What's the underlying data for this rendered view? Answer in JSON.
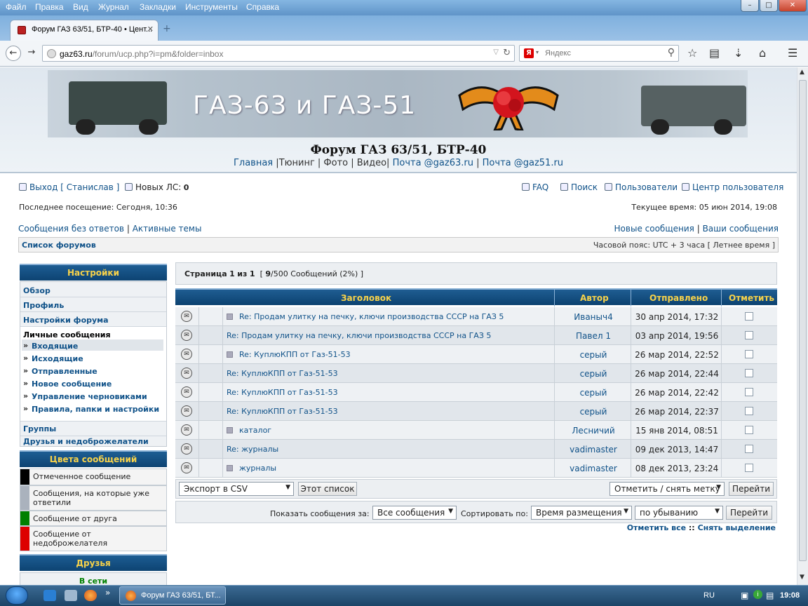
{
  "menubar": {
    "items": [
      "Файл",
      "Правка",
      "Вид",
      "Журнал",
      "Закладки",
      "Инструменты",
      "Справка"
    ]
  },
  "window": {
    "min": "–",
    "max": "□",
    "close": "✕"
  },
  "tab": {
    "title": "Форум ГАЗ 63/51, БТР-40 • Цент...",
    "close": "✕",
    "new": "+"
  },
  "nav": {
    "back": "←",
    "forward": "→",
    "url_host": "gaz63.ru",
    "url_path": "/forum/ucp.php?i=pm&folder=inbox",
    "search_placeholder": "Яндекс",
    "search_engine": "Я"
  },
  "banner": {
    "title": "ГАЗ-63 и ГАЗ-51"
  },
  "forum": {
    "title": "Форум ГАЗ 63/51, БТР-40",
    "links": [
      "Главная",
      "|Тюнинг | Фото | Видео|",
      "Почта @gaz63.ru",
      "|",
      "Почта @gaz51.ru"
    ]
  },
  "userbar": {
    "logout": "Выход [ Станислав ]",
    "new_pm": "Новых ЛС:",
    "new_pm_count": "0",
    "faq": "FAQ",
    "search": "Поиск",
    "members": "Пользователи",
    "ucp": "Центр пользователя",
    "last_visit": "Последнее посещение: Сегодня, 10:36",
    "current_time": "Текущее время: 05 июн 2014, 19:08",
    "unanswered": "Сообщения без ответов",
    "sep": "|",
    "active": "Активные темы",
    "new_posts": "Новые сообщения",
    "your_posts": "Ваши сообщения"
  },
  "crumbs": {
    "forum_index": "Список форумов",
    "timezone": "Часовой пояс: UTC + 3 часа [ Летнее время ]"
  },
  "sidebar": {
    "settings_head": "Настройки",
    "items": [
      "Обзор",
      "Профиль",
      "Настройки форума"
    ],
    "pm_label": "Личные сообщения",
    "pm_items": [
      "Входящие",
      "Исходящие",
      "Отправленные",
      "Новое сообщение",
      "Управление черновиками",
      "Правила, папки и настройки"
    ],
    "groups": "Группы",
    "friends_foes": "Друзья и недоброжелатели",
    "colors_head": "Цвета сообщений",
    "colors": [
      {
        "label": "Отмеченное сообщение",
        "color": "#000000"
      },
      {
        "label": "Сообщения, на которые уже ответили",
        "color": "#aab2bd"
      },
      {
        "label": "Сообщение от друга",
        "color": "#008000"
      },
      {
        "label": "Сообщение от недоброжелателя",
        "color": "#dd0000"
      }
    ],
    "friends_head": "Друзья",
    "online": "В сети"
  },
  "pagination": {
    "page": "Страница",
    "cur": "1",
    "of": "из",
    "total": "1",
    "open": "[",
    "count": "9",
    "rest": "/500 Сообщений (2%) ]"
  },
  "table": {
    "headers": {
      "subject": "Заголовок",
      "author": "Автор",
      "sent": "Отправлено",
      "mark": "Отметить"
    },
    "rows": [
      {
        "subject": "Re: Продам улитку на печку, ключи производства СССР на ГАЗ 5",
        "author": "Иваныч4",
        "date": "30 апр 2014, 17:32",
        "flag": true
      },
      {
        "subject": "Re: Продам улитку на печку, ключи производства СССР на ГАЗ 5",
        "author": "Павел 1",
        "date": "03 апр 2014, 19:56",
        "flag": false
      },
      {
        "subject": "Re: КуплюКПП от Газ-51-53",
        "author": "серый",
        "date": "26 мар 2014, 22:52",
        "flag": true
      },
      {
        "subject": "Re: КуплюКПП от Газ-51-53",
        "author": "серый",
        "date": "26 мар 2014, 22:44",
        "flag": false
      },
      {
        "subject": "Re: КуплюКПП от Газ-51-53",
        "author": "серый",
        "date": "26 мар 2014, 22:42",
        "flag": false
      },
      {
        "subject": "Re: КуплюКПП от Газ-51-53",
        "author": "серый",
        "date": "26 мар 2014, 22:37",
        "flag": false
      },
      {
        "subject": "каталог",
        "author": "Лесничий",
        "date": "15 янв 2014, 08:51",
        "flag": true
      },
      {
        "subject": "Re: журналы",
        "author": "vadimaster",
        "date": "09 дек 2013, 14:47",
        "flag": false
      },
      {
        "subject": "журналы",
        "author": "vadimaster",
        "date": "08 дек 2013, 23:24",
        "flag": true
      }
    ]
  },
  "actions": {
    "export": "Экспорт в CSV",
    "this_list": "Этот список",
    "mark_select": "Отметить / снять метку",
    "go": "Перейти"
  },
  "filters": {
    "show_label": "Показать сообщения за:",
    "show_value": "Все сообщения",
    "sort_label": "Сортировать по:",
    "sort_value": "Время размещения",
    "order_value": "по убыванию",
    "go": "Перейти"
  },
  "marklinks": {
    "mark_all": "Отметить все",
    "sep": "::",
    "unmark": "Снять выделение"
  },
  "taskbar": {
    "app": "Форум ГАЗ 63/51, БТ...",
    "lang": "RU",
    "time": "19:08"
  }
}
